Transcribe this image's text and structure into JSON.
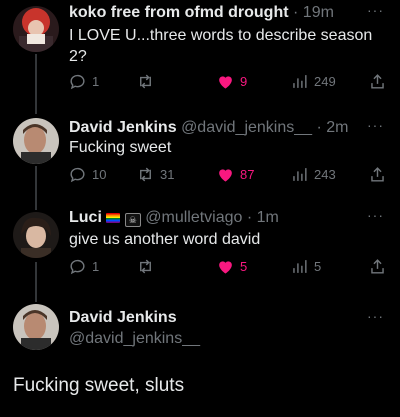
{
  "tweets": [
    {
      "name": "koko free from ofmd drought",
      "handle": "",
      "time": "19m",
      "text": "I LOVE U...three words to describe season 2?",
      "replies": "1",
      "retweets": "",
      "likes": "9",
      "views": "249"
    },
    {
      "name": "David Jenkins",
      "handle": "@david_jenkins__",
      "time": "2m",
      "text": "Fucking sweet",
      "replies": "10",
      "retweets": "31",
      "likes": "87",
      "views": "243"
    },
    {
      "name": "Luci",
      "handle": "@mulletviago",
      "time": "1m",
      "text": "give us another word david",
      "replies": "1",
      "retweets": "",
      "likes": "5",
      "views": "5"
    }
  ],
  "main_tweet": {
    "name": "David Jenkins",
    "handle": "@david_jenkins__",
    "text": "Fucking sweet, sluts"
  },
  "colors": {
    "background": "#000000",
    "text": "#e7e9ea",
    "muted": "#71767b",
    "like": "#f91880"
  },
  "icons": {
    "reply": "reply-icon",
    "retweet": "retweet-icon",
    "like": "heart-icon",
    "views": "views-icon",
    "share": "share-icon",
    "more": "more-icon"
  }
}
